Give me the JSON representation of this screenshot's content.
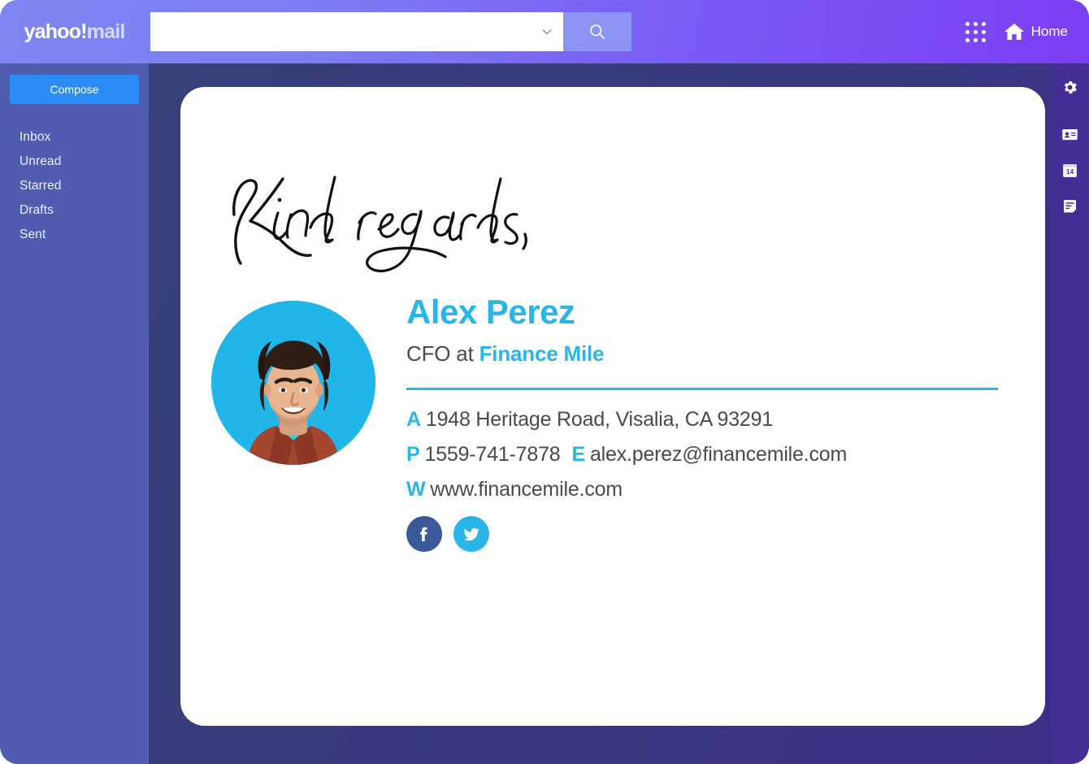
{
  "header": {
    "logo_yahoo": "yahoo",
    "logo_bang": "!",
    "logo_mail": "mail",
    "search": {
      "value": "",
      "placeholder": "",
      "dropdown_icon": "chevron-down-icon",
      "button_icon": "search-icon"
    },
    "apps_icon": "apps-grid-icon",
    "home_icon": "home-icon",
    "home_label": "Home",
    "gradient_start": "#7d86f2",
    "gradient_end": "#7c3ef4"
  },
  "sidebar": {
    "compose_label": "Compose",
    "compose_color": "#2b8cf6",
    "background": "#4f5cb0",
    "items": [
      {
        "label": "Inbox"
      },
      {
        "label": "Unread"
      },
      {
        "label": "Starred"
      },
      {
        "label": "Drafts"
      },
      {
        "label": "Sent"
      }
    ]
  },
  "right_rail": {
    "background": "#452d96",
    "items": [
      {
        "icon": "gear-icon",
        "label": "Settings"
      },
      {
        "icon": "contacts-card-icon",
        "label": "Contacts"
      },
      {
        "icon": "calendar-icon",
        "label": "Calendar",
        "day": "14"
      },
      {
        "icon": "notepad-icon",
        "label": "Notepad"
      }
    ]
  },
  "stage": {
    "background_start": "#374179",
    "background_end": "#3b2f86"
  },
  "signature": {
    "closing": "Kind regards,",
    "avatar": {
      "alt": "Smiling man with dark wavy hair wearing a rust shirt",
      "background": "#21b5e8"
    },
    "name": "Alex Perez",
    "role_prefix": "CFO at ",
    "company": "Finance Mile",
    "accent_color": "#2ab5e8",
    "divider_color": "#29b6e8",
    "contact": [
      {
        "key": "A",
        "value": "1948 Heritage Road, Visalia, CA 93291"
      },
      {
        "key": "P",
        "value": "1559-741-7878",
        "key2": "E",
        "value2": "alex.perez@financemile.com"
      },
      {
        "key": "W",
        "value": "www.financemile.com"
      }
    ],
    "socials": [
      {
        "name": "facebook",
        "color": "#3b5998"
      },
      {
        "name": "twitter",
        "color": "#2ab5e8"
      }
    ]
  }
}
